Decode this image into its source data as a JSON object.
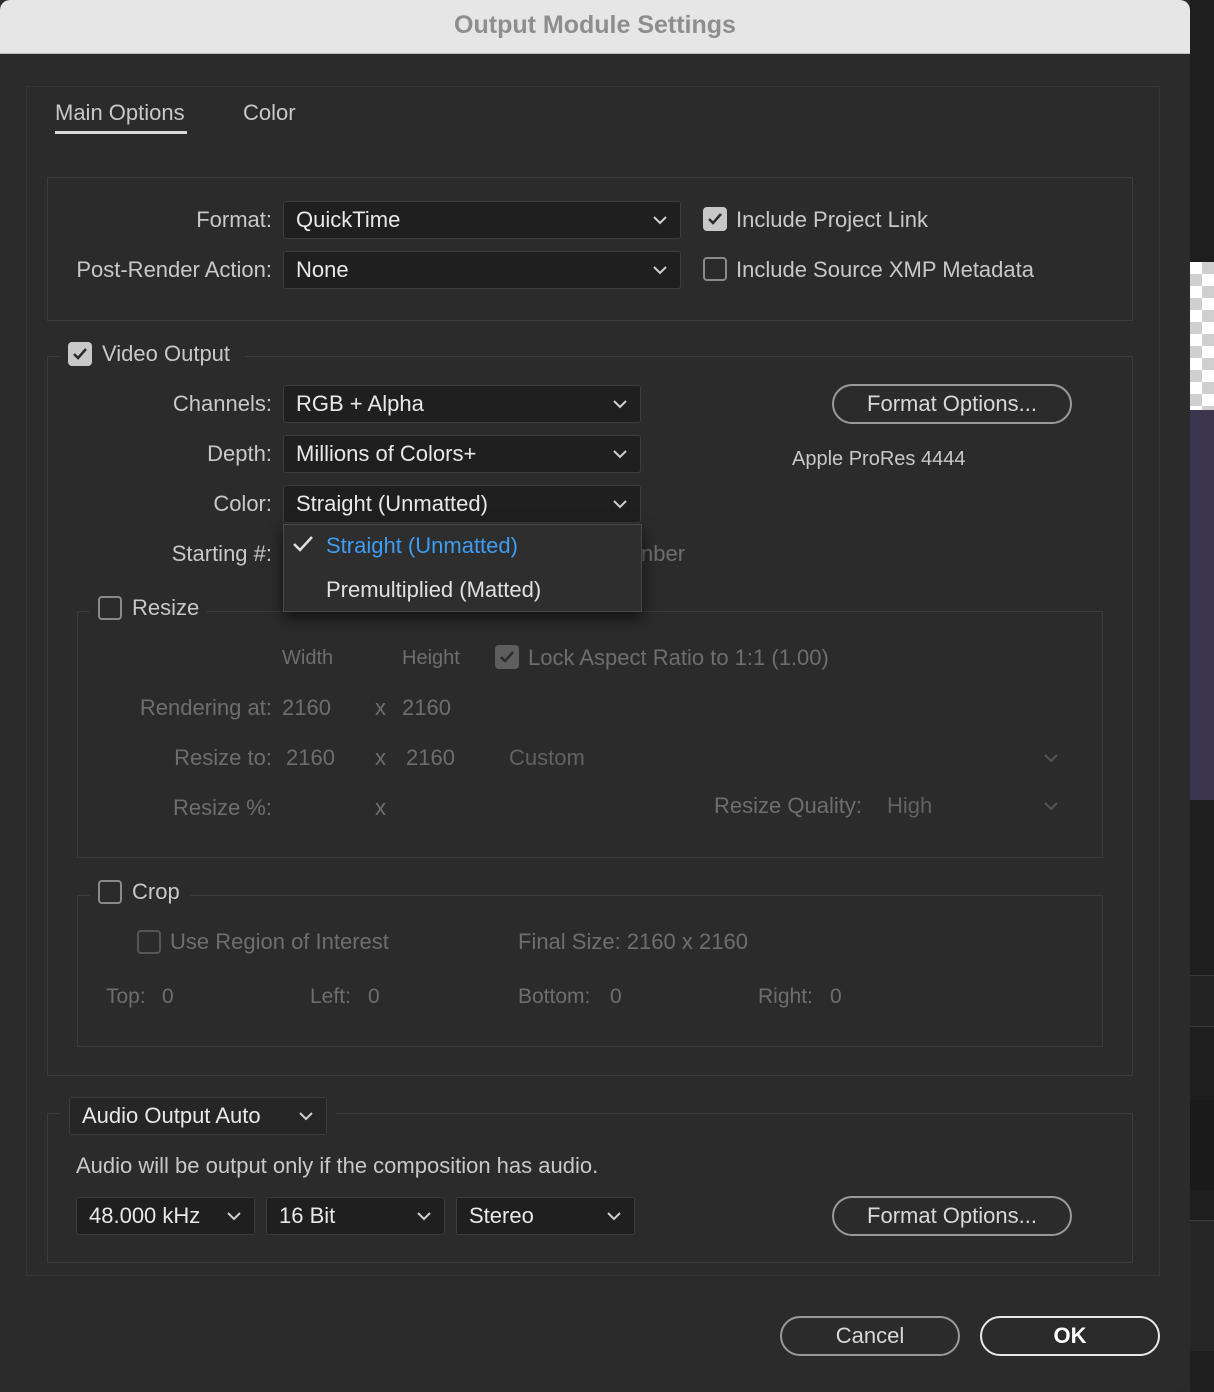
{
  "window": {
    "title": "Output Module Settings"
  },
  "tabs": [
    {
      "label": "Main Options",
      "active": true
    },
    {
      "label": "Color",
      "active": false
    }
  ],
  "top": {
    "format_label": "Format:",
    "format_value": "QuickTime",
    "post_render_label": "Post-Render Action:",
    "post_render_value": "None",
    "include_project_link": {
      "label": "Include Project Link",
      "checked": true
    },
    "include_xmp": {
      "label": "Include Source XMP Metadata",
      "checked": false
    }
  },
  "video": {
    "checkbox_label": "Video Output",
    "checked": true,
    "channels_label": "Channels:",
    "channels_value": "RGB + Alpha",
    "depth_label": "Depth:",
    "depth_value": "Millions of Colors+",
    "color_label": "Color:",
    "color_value": "Straight (Unmatted)",
    "starting_label": "Starting #:",
    "starting_hidden_text": "nber",
    "format_options_label": "Format Options...",
    "codec_text": "Apple ProRes 4444",
    "color_menu": [
      {
        "label": "Straight (Unmatted)",
        "selected": true
      },
      {
        "label": "Premultiplied (Matted)",
        "selected": false
      }
    ]
  },
  "resize": {
    "checkbox_label": "Resize",
    "checked": false,
    "width_header": "Width",
    "height_header": "Height",
    "lock_aspect_label": "Lock Aspect Ratio to 1:1 (1.00)",
    "lock_aspect_checked": true,
    "rendering_at_label": "Rendering at:",
    "rendering_w": "2160",
    "rendering_h": "2160",
    "resize_to_label": "Resize to:",
    "resize_to_w": "2160",
    "resize_to_h": "2160",
    "preset_value": "Custom",
    "resize_pct_label": "Resize %:",
    "x_symbol": "x",
    "quality_label": "Resize Quality:",
    "quality_value": "High"
  },
  "crop": {
    "checkbox_label": "Crop",
    "checked": false,
    "roi_label": "Use Region of Interest",
    "final_size": "Final Size: 2160 x 2160",
    "top_label": "Top:",
    "top_value": "0",
    "left_label": "Left:",
    "left_value": "0",
    "bottom_label": "Bottom:",
    "bottom_value": "0",
    "right_label": "Right:",
    "right_value": "0"
  },
  "audio": {
    "output_mode": "Audio Output Auto",
    "note": "Audio will be output only if the composition has audio.",
    "rate": "48.000 kHz",
    "bits": "16 Bit",
    "channels": "Stereo",
    "format_options_label": "Format Options..."
  },
  "footer": {
    "cancel_label": "Cancel",
    "ok_label": "OK"
  }
}
